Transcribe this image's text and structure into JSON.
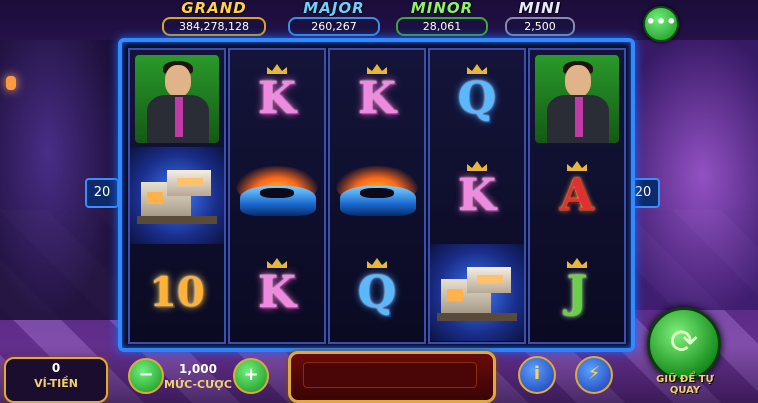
{
  "jackpots": {
    "grand": {
      "name": "GRAND",
      "value": "384,278,128"
    },
    "major": {
      "name": "MAJOR",
      "value": "260,267"
    },
    "minor": {
      "name": "MINOR",
      "value": "28,061"
    },
    "mini": {
      "name": "MINI",
      "value": "2,500"
    }
  },
  "menu": {
    "icon": "more-dots-icon",
    "glyph": "•••"
  },
  "paylines": {
    "left": "20",
    "right": "20"
  },
  "reels": [
    [
      "man",
      "house",
      "10"
    ],
    [
      "K",
      "car",
      "K"
    ],
    [
      "K",
      "car",
      "Q"
    ],
    [
      "Q",
      "K",
      "house"
    ],
    [
      "man",
      "A",
      "J"
    ]
  ],
  "bottom": {
    "wallet_value": "0",
    "wallet_label": "VÍ-TIỀN",
    "bet_value": "1,000",
    "bet_label": "MỨC-CƯỢC",
    "minus_label": "−",
    "plus_label": "+",
    "info_label": "i",
    "turbo_label": "⚡",
    "spin_glyph": "⟳",
    "autospin_label": "GIỮ ĐỂ TỰ QUAY"
  },
  "colors": {
    "frame": "#2f8bff",
    "spin_button": "#19901f",
    "gold_trim": "#e0a93a"
  }
}
